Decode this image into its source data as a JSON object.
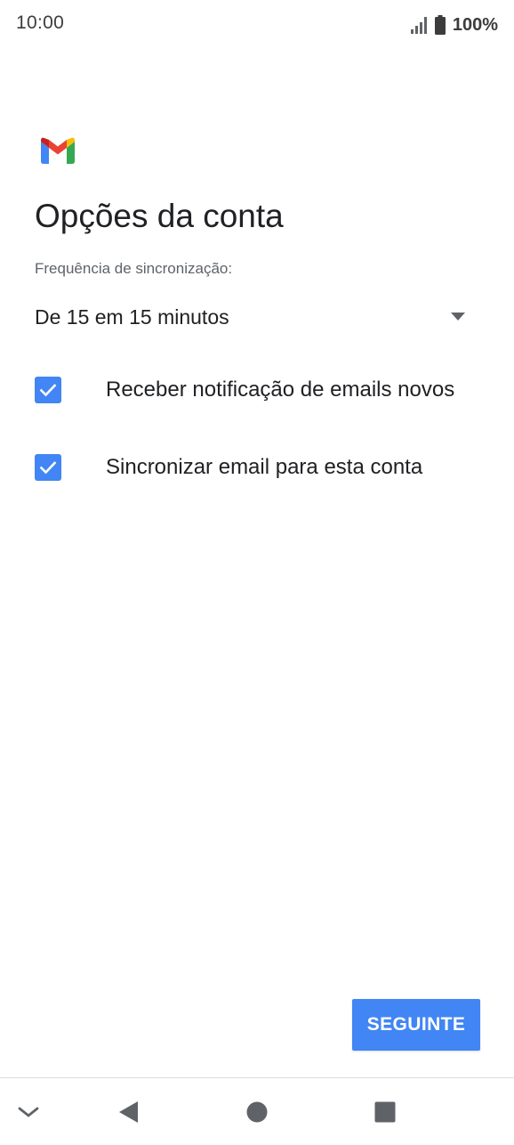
{
  "status_bar": {
    "time": "10:00",
    "battery": "100%",
    "icons": [
      "signal-icon",
      "battery-icon"
    ]
  },
  "header": {
    "logo": "gmail-logo",
    "title": "Opções da conta"
  },
  "sync": {
    "label": "Frequência de sincronização:",
    "selected": "De 15 em 15 minutos"
  },
  "options": [
    {
      "label": "Receber notificação de emails novos",
      "checked": true
    },
    {
      "label": "Sincronizar email para esta conta",
      "checked": true
    }
  ],
  "actions": {
    "next_label": "SEGUINTE"
  },
  "nav_bar": {
    "icons": [
      "chevron-down-icon",
      "back-icon",
      "home-icon",
      "recents-icon"
    ]
  },
  "colors": {
    "accent": "#4285f4",
    "text_primary": "#202124",
    "text_secondary": "#5f6368"
  }
}
